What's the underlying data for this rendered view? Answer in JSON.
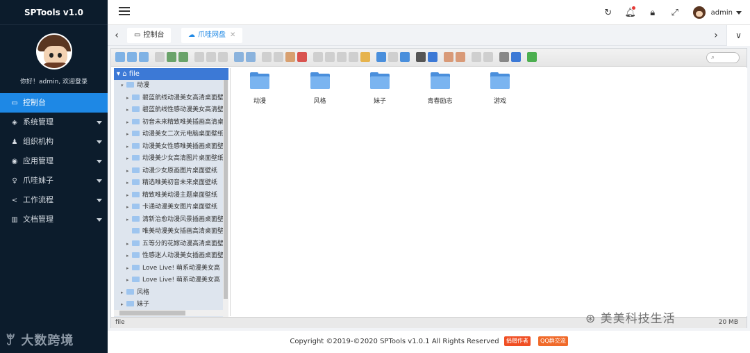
{
  "app": {
    "title": "SPTools v1.0"
  },
  "sidebar": {
    "welcome": "你好！admin, 欢迎登录",
    "items": [
      {
        "label": "控制台",
        "icon": "monitor-icon",
        "glyph": "▭",
        "active": true,
        "caret": false
      },
      {
        "label": "系统管理",
        "icon": "layers-icon",
        "glyph": "◈",
        "active": false,
        "caret": true
      },
      {
        "label": "组织机构",
        "icon": "users-icon",
        "glyph": "♟",
        "active": false,
        "caret": true
      },
      {
        "label": "应用管理",
        "icon": "compass-icon",
        "glyph": "◉",
        "active": false,
        "caret": true
      },
      {
        "label": "爪哇妹子",
        "icon": "female-icon",
        "glyph": "♀",
        "active": false,
        "caret": true
      },
      {
        "label": "工作流程",
        "icon": "share-icon",
        "glyph": "<",
        "active": false,
        "caret": true
      },
      {
        "label": "文档管理",
        "icon": "book-icon",
        "glyph": "▥",
        "active": false,
        "caret": true
      }
    ],
    "logo_text": "大数跨境"
  },
  "topbar": {
    "username": "admin",
    "icons": [
      "refresh-icon",
      "bell-icon",
      "lock-icon",
      "fullscreen-icon"
    ]
  },
  "tabs": [
    {
      "label": "控制台",
      "icon": "monitor-icon",
      "active": false,
      "closable": false
    },
    {
      "label": "爪哇网盘",
      "icon": "cloud-icon",
      "active": true,
      "closable": true
    }
  ],
  "filemanager": {
    "search_placeholder": "",
    "tree": {
      "root": "file",
      "open_folder": "动漫",
      "children": [
        "碧蓝航线动漫美女高清桌面壁",
        "碧蓝航线性感动漫美女高清壁",
        "初音未来精致唯美插画高清桌",
        "动漫美女二次元电脑桌面壁纸",
        "动漫美女性感唯美插画桌面壁",
        "动漫美少女高清图片桌面壁纸",
        "动漫少女原画图片桌面壁纸",
        "精选唯美初音未来桌面壁纸",
        "精致唯美动漫主题桌面壁纸",
        "卡通动漫美女图片桌面壁纸",
        "清新治愈动漫风景插画桌面壁",
        "唯美动漫美女插画高清桌面壁",
        "五等分的花嫁动漫高清桌面壁",
        "性感迷人动漫美女插画桌面壁",
        "Love Live! 萌系动漫美女高",
        "Love Live! 萌系动漫美女高"
      ],
      "siblings": [
        "风格",
        "妹子"
      ]
    },
    "folders": [
      "动漫",
      "风格",
      "妹子",
      "青春励志",
      "游戏"
    ],
    "status_path": "file",
    "status_size": "20 MB"
  },
  "footer": {
    "copyright": "Copyright ©2019-©2020 SPTools v1.0.1 All Rights Reserved",
    "badge1": "捐赠作者",
    "badge2": "QQ群交流"
  },
  "watermark": "美美科技生活"
}
